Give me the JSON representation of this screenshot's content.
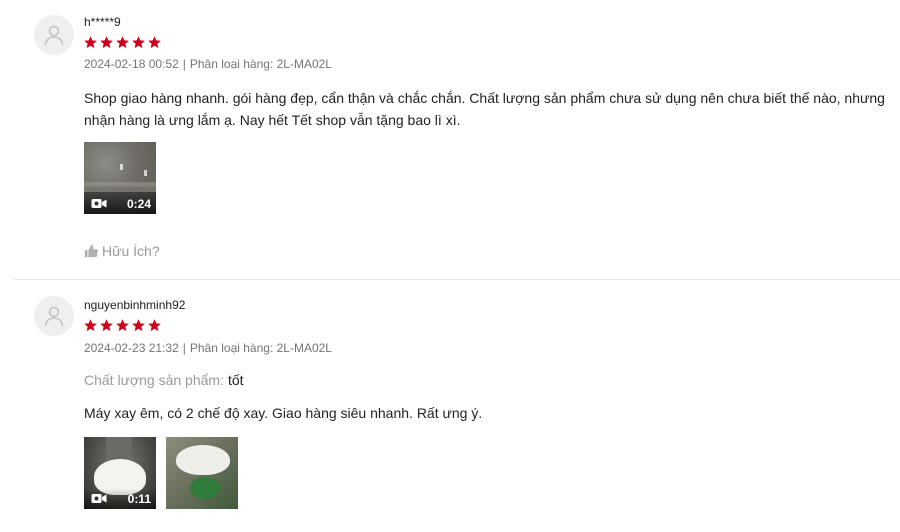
{
  "colors": {
    "star": "#d0011b",
    "meta_text": "#757575",
    "muted_text": "#9a9a9a",
    "divider": "#e5e5e5",
    "avatar_bg": "#efefef"
  },
  "reviews": [
    {
      "username": "h*****9",
      "rating": 5,
      "date": "2024-02-18 00:52",
      "separator": "|",
      "variation": "Phân loại hàng: 2L-MA02L",
      "content_lines": [
        "Shop giao hàng nhanh. gói hàng đẹp, cẩn thận và chắc chắn. Chất lượng sản phẩm chưa sử dụng nên chưa biết thế nào, nhưng",
        "nhận hàng là ưng lắm ạ. Nay hết Tết shop vẫn tặng bao lì xì."
      ],
      "media": [
        {
          "type": "video",
          "icon": "video-camera-icon",
          "duration": "0:24"
        }
      ],
      "helpful_icon": "thumbs-up-icon",
      "helpful_label": "Hữu Ích?"
    },
    {
      "username": "nguyenbinhminh92",
      "rating": 5,
      "date": "2024-02-23 21:32",
      "separator": "|",
      "variation": "Phân loại hàng: 2L-MA02L",
      "quality_label": "Chất lượng sản phẩm:",
      "quality_value": "tốt",
      "content_lines": [
        "Máy xay êm, có 2 chế độ xay. Giao hàng siêu nhanh. Rất ưng ý."
      ],
      "media": [
        {
          "type": "video",
          "icon": "video-camera-icon",
          "duration": "0:11"
        },
        {
          "type": "image"
        }
      ]
    }
  ]
}
